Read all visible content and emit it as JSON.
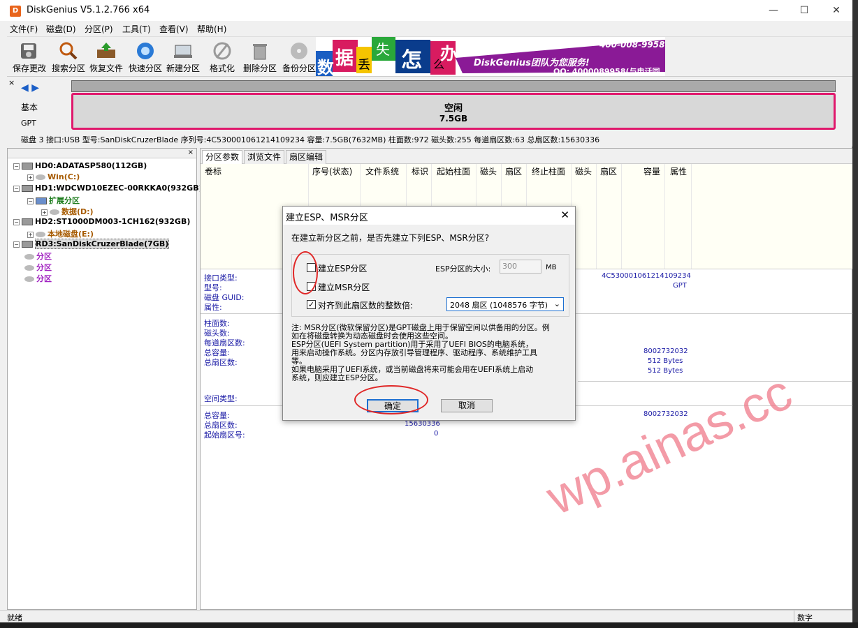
{
  "window": {
    "title": "DiskGenius V5.1.2.766 x64",
    "icon_text": "D",
    "min": "—",
    "max": "☐",
    "close": "✕"
  },
  "menu": [
    "文件(F)",
    "磁盘(D)",
    "分区(P)",
    "工具(T)",
    "查看(V)",
    "帮助(H)"
  ],
  "toolbar": [
    "保存更改",
    "搜索分区",
    "恢复文件",
    "快速分区",
    "新建分区",
    "格式化",
    "删除分区",
    "备份分区"
  ],
  "banner": {
    "chars": [
      "数",
      "据",
      "丢",
      "失",
      "怎",
      "么",
      "办"
    ],
    "brand": "DiskGenius团队为您服务!",
    "phone": "400-008-9958",
    "qq": "QQ: 4000089958(与电话同号)"
  },
  "diskmap": {
    "close": "×",
    "nav": "◀ ▶",
    "basic": "基本",
    "gpt": "GPT",
    "free_label": "空闲",
    "free_size": "7.5GB",
    "info": "磁盘 3 接口:USB  型号:SanDiskCruzerBlade  序列号:4C530001061214109234  容量:7.5GB(7632MB)  柱面数:972  磁头数:255  每道扇区数:63  总扇区数:15630336"
  },
  "tree": {
    "close": "×",
    "items": [
      {
        "label": "HD0:ADATASP580(112GB)",
        "color": "#000000"
      },
      {
        "label": "Win(C:)",
        "color": "#a65a00"
      },
      {
        "label": "HD1:WDCWD10EZEC-00RKKA0(932GB)",
        "color": "#000000"
      },
      {
        "label": "扩展分区",
        "color": "#1b7b1b"
      },
      {
        "label": "数据(D:)",
        "color": "#a65a00"
      },
      {
        "label": "HD2:ST1000DM003-1CH162(932GB)",
        "color": "#000000"
      },
      {
        "label": "本地磁盘(E:)",
        "color": "#a65a00"
      },
      {
        "label": "RD3:SanDiskCruzerBlade(7GB)",
        "color": "#000000"
      },
      {
        "label": "分区",
        "color": "#a020c0"
      },
      {
        "label": "分区",
        "color": "#a020c0"
      },
      {
        "label": "分区",
        "color": "#a020c0"
      }
    ]
  },
  "tabs": [
    "分区参数",
    "浏览文件",
    "扇区编辑"
  ],
  "columns": [
    "卷标",
    "序号(状态)",
    "文件系统",
    "标识",
    "起始柱面",
    "磁头",
    "扇区",
    "终止柱面",
    "磁头",
    "扇区",
    "容量",
    "属性"
  ],
  "props": {
    "iface_labels": [
      "接口类型:",
      "型号:",
      "磁盘 GUID:",
      "属性:"
    ],
    "serial": "4C530001061214109234",
    "parttype": "GPT",
    "geo_labels": [
      "柱面数:",
      "磁头数:",
      "每道扇区数:",
      "总容量:",
      "总扇区数:"
    ],
    "geo_vals": [
      "8002732032",
      "512 Bytes",
      "512 Bytes"
    ],
    "space_label": "空间类型:",
    "cap_labels": [
      "总容量:",
      "总扇区数:",
      "起始扇区号:"
    ],
    "cap_vals_mid": [
      "15630336",
      "0"
    ],
    "cap_val_right": "8002732032"
  },
  "status": {
    "left": "就绪",
    "right": "数字"
  },
  "dialog": {
    "title": "建立ESP、MSR分区",
    "close": "✕",
    "question": "在建立新分区之前，是否先建立下列ESP、MSR分区?",
    "esp_label": "建立ESP分区",
    "msr_label": "建立MSR分区",
    "size_label": "ESP分区的大小:",
    "size_value": "300",
    "size_unit": "MB",
    "align_label": "对齐到此扇区数的整数倍:",
    "align_value": "2048 扇区 (1048576 字节)",
    "check": "✓",
    "note": [
      "注: MSR分区(微软保留分区)是GPT磁盘上用于保留空间以供备用的分区。例",
      "如在将磁盘转换为动态磁盘时会使用这些空间。",
      "     ESP分区(UEFI System partition)用于采用了UEFI BIOS的电脑系统，",
      "用来启动操作系统。分区内存放引导管理程序、驱动程序、系统维护工具",
      "等。",
      "     如果电脑采用了UEFI系统，或当前磁盘将来可能会用在UEFI系统上启动",
      "系统，则应建立ESP分区。"
    ],
    "ok": "确定",
    "cancel": "取消",
    "annot_color": "#e02828"
  },
  "watermark": "wp.ainas.cc"
}
